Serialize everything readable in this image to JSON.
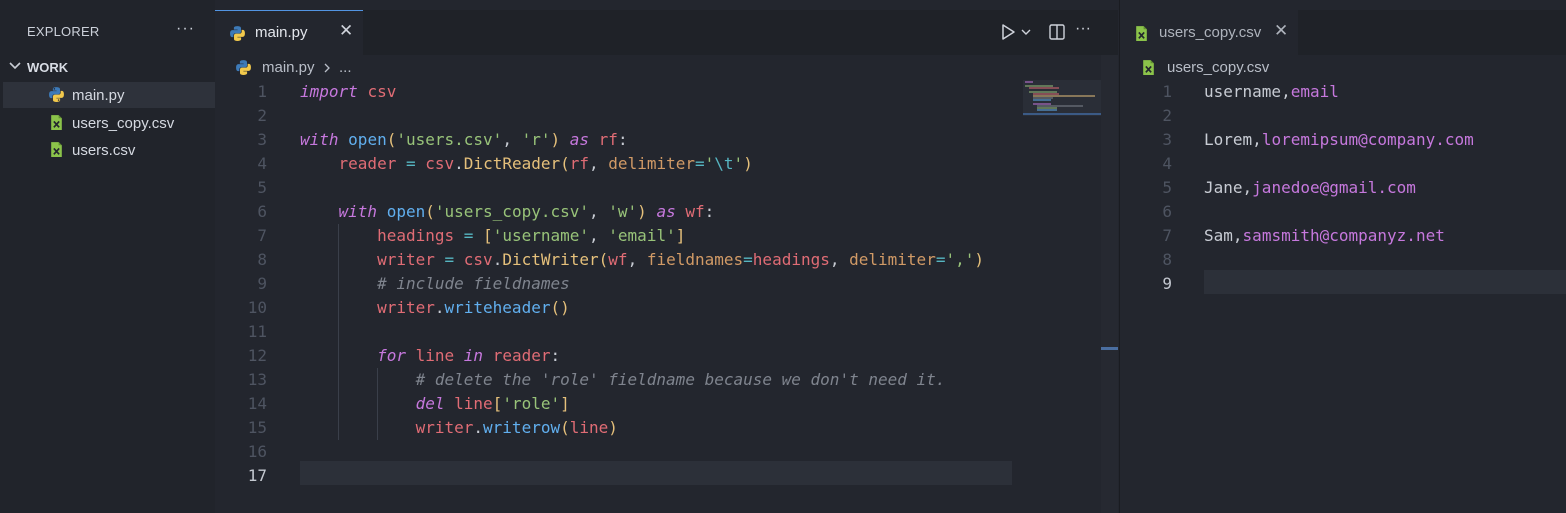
{
  "sidebar": {
    "title": "EXPLORER",
    "more": "···",
    "folder": "WORK",
    "files": [
      {
        "label": "main.py",
        "icon": "python-icon"
      },
      {
        "label": "users_copy.csv",
        "icon": "csv-file-icon"
      },
      {
        "label": "users.csv",
        "icon": "csv-file-icon"
      }
    ]
  },
  "main_editor": {
    "tab_label": "main.py",
    "breadcrumb": {
      "file": "main.py",
      "rest": "..."
    },
    "current_line": 17,
    "lines": [
      {
        "n": "1",
        "tokens": [
          [
            "kw",
            "import"
          ],
          [
            "pl",
            " "
          ],
          [
            "id",
            "csv"
          ]
        ]
      },
      {
        "n": "2",
        "tokens": []
      },
      {
        "n": "3",
        "tokens": [
          [
            "kw",
            "with"
          ],
          [
            "pl",
            " "
          ],
          [
            "fn",
            "open"
          ],
          [
            "par",
            "("
          ],
          [
            "str",
            "'users.csv'"
          ],
          [
            "pl",
            ", "
          ],
          [
            "str",
            "'r'"
          ],
          [
            "par",
            ")"
          ],
          [
            "pl",
            " "
          ],
          [
            "kw",
            "as"
          ],
          [
            "pl",
            " "
          ],
          [
            "id",
            "rf"
          ],
          [
            "pl",
            ":"
          ]
        ]
      },
      {
        "n": "4",
        "tokens": [
          [
            "pl",
            "    "
          ],
          [
            "id",
            "reader"
          ],
          [
            "pl",
            " "
          ],
          [
            "op",
            "="
          ],
          [
            "pl",
            " "
          ],
          [
            "id",
            "csv"
          ],
          [
            "pl",
            "."
          ],
          [
            "par",
            "DictReader"
          ],
          [
            "par",
            "("
          ],
          [
            "id",
            "rf"
          ],
          [
            "pl",
            ", "
          ],
          [
            "pn",
            "delimiter"
          ],
          [
            "op",
            "="
          ],
          [
            "str",
            "'"
          ],
          [
            "esc",
            "\\t"
          ],
          [
            "str",
            "'"
          ],
          [
            "par",
            ")"
          ]
        ]
      },
      {
        "n": "5",
        "tokens": []
      },
      {
        "n": "6",
        "tokens": [
          [
            "pl",
            "    "
          ],
          [
            "kw",
            "with"
          ],
          [
            "pl",
            " "
          ],
          [
            "fn",
            "open"
          ],
          [
            "par",
            "("
          ],
          [
            "str",
            "'users_copy.csv'"
          ],
          [
            "pl",
            ", "
          ],
          [
            "str",
            "'w'"
          ],
          [
            "par",
            ")"
          ],
          [
            "pl",
            " "
          ],
          [
            "kw",
            "as"
          ],
          [
            "pl",
            " "
          ],
          [
            "id",
            "wf"
          ],
          [
            "pl",
            ":"
          ]
        ]
      },
      {
        "n": "7",
        "tokens": [
          [
            "pl",
            "        "
          ],
          [
            "id",
            "headings"
          ],
          [
            "pl",
            " "
          ],
          [
            "op",
            "="
          ],
          [
            "pl",
            " "
          ],
          [
            "par",
            "["
          ],
          [
            "str",
            "'username'"
          ],
          [
            "pl",
            ", "
          ],
          [
            "str",
            "'email'"
          ],
          [
            "par",
            "]"
          ]
        ]
      },
      {
        "n": "8",
        "tokens": [
          [
            "pl",
            "        "
          ],
          [
            "id",
            "writer"
          ],
          [
            "pl",
            " "
          ],
          [
            "op",
            "="
          ],
          [
            "pl",
            " "
          ],
          [
            "id",
            "csv"
          ],
          [
            "pl",
            "."
          ],
          [
            "par",
            "DictWriter"
          ],
          [
            "par",
            "("
          ],
          [
            "id",
            "wf"
          ],
          [
            "pl",
            ", "
          ],
          [
            "pn",
            "fieldnames"
          ],
          [
            "op",
            "="
          ],
          [
            "id",
            "headings"
          ],
          [
            "pl",
            ", "
          ],
          [
            "pn",
            "delimiter"
          ],
          [
            "op",
            "="
          ],
          [
            "str",
            "','"
          ],
          [
            "par",
            ")"
          ]
        ]
      },
      {
        "n": "9",
        "tokens": [
          [
            "pl",
            "        "
          ],
          [
            "cm",
            "# include fieldnames"
          ]
        ]
      },
      {
        "n": "10",
        "tokens": [
          [
            "pl",
            "        "
          ],
          [
            "id",
            "writer"
          ],
          [
            "pl",
            "."
          ],
          [
            "fn",
            "writeheader"
          ],
          [
            "par",
            "()"
          ]
        ]
      },
      {
        "n": "11",
        "tokens": []
      },
      {
        "n": "12",
        "tokens": [
          [
            "pl",
            "        "
          ],
          [
            "kw",
            "for"
          ],
          [
            "pl",
            " "
          ],
          [
            "id",
            "line"
          ],
          [
            "pl",
            " "
          ],
          [
            "kw",
            "in"
          ],
          [
            "pl",
            " "
          ],
          [
            "id",
            "reader"
          ],
          [
            "pl",
            ":"
          ]
        ]
      },
      {
        "n": "13",
        "tokens": [
          [
            "pl",
            "            "
          ],
          [
            "cm",
            "# delete the 'role' fieldname because we don't need it."
          ]
        ]
      },
      {
        "n": "14",
        "tokens": [
          [
            "pl",
            "            "
          ],
          [
            "kw",
            "del"
          ],
          [
            "pl",
            " "
          ],
          [
            "id",
            "line"
          ],
          [
            "par",
            "["
          ],
          [
            "str",
            "'role'"
          ],
          [
            "par",
            "]"
          ]
        ]
      },
      {
        "n": "15",
        "tokens": [
          [
            "pl",
            "            "
          ],
          [
            "id",
            "writer"
          ],
          [
            "pl",
            "."
          ],
          [
            "fn",
            "writerow"
          ],
          [
            "par",
            "("
          ],
          [
            "id",
            "line"
          ],
          [
            "par",
            ")"
          ]
        ]
      },
      {
        "n": "16",
        "tokens": []
      },
      {
        "n": "17",
        "tokens": []
      }
    ]
  },
  "right_editor": {
    "tab_label": "users_copy.csv",
    "breadcrumb": "users_copy.csv",
    "current_line": 9,
    "lines": [
      {
        "n": "1",
        "tokens": [
          [
            "csv-a",
            "username"
          ],
          [
            "pl",
            ","
          ],
          [
            "csv-b",
            "email"
          ]
        ]
      },
      {
        "n": "2",
        "tokens": []
      },
      {
        "n": "3",
        "tokens": [
          [
            "csv-a",
            "Lorem"
          ],
          [
            "pl",
            ","
          ],
          [
            "csv-b",
            "loremipsum@company.com"
          ]
        ]
      },
      {
        "n": "4",
        "tokens": []
      },
      {
        "n": "5",
        "tokens": [
          [
            "csv-a",
            "Jane"
          ],
          [
            "pl",
            ","
          ],
          [
            "csv-b",
            "janedoe@gmail.com"
          ]
        ]
      },
      {
        "n": "6",
        "tokens": []
      },
      {
        "n": "7",
        "tokens": [
          [
            "csv-a",
            "Sam"
          ],
          [
            "pl",
            ","
          ],
          [
            "csv-b",
            "samsmith@companyz.net"
          ]
        ]
      },
      {
        "n": "8",
        "tokens": []
      },
      {
        "n": "9",
        "tokens": []
      }
    ]
  },
  "colors": {
    "accent": "#5294e2",
    "python_blue": "#3d7ab8",
    "python_yellow": "#f2c94c",
    "csv_green": "#8bc34a"
  }
}
